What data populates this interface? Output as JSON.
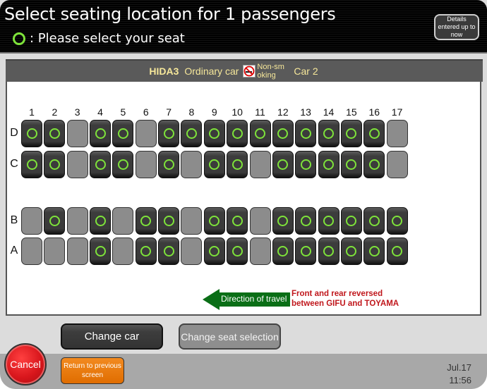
{
  "header": {
    "title": "Select seating location for 1 passengers",
    "legend_text": ": Please select your seat",
    "legend_icon": "green-circle-available-icon",
    "details_button": "Details entered up to now"
  },
  "car": {
    "train_name": "HIDA3",
    "car_type": "Ordinary car",
    "smoking_icon": "no-smoking-icon",
    "smoking_label": "Non-smoking",
    "car_number": "Car 2"
  },
  "seat_map": {
    "columns": [
      "1",
      "2",
      "3",
      "4",
      "5",
      "6",
      "7",
      "8",
      "9",
      "10",
      "11",
      "12",
      "13",
      "14",
      "15",
      "16",
      "17"
    ],
    "rows": [
      {
        "label": "D",
        "available": [
          true,
          true,
          false,
          true,
          true,
          false,
          true,
          true,
          true,
          true,
          true,
          true,
          true,
          true,
          true,
          true,
          false
        ]
      },
      {
        "label": "C",
        "available": [
          true,
          true,
          false,
          true,
          true,
          false,
          true,
          false,
          true,
          true,
          false,
          true,
          true,
          true,
          true,
          true,
          false
        ]
      },
      {
        "label": "B",
        "available": [
          false,
          true,
          false,
          true,
          false,
          true,
          true,
          false,
          true,
          true,
          false,
          true,
          true,
          true,
          true,
          true,
          true
        ]
      },
      {
        "label": "A",
        "available": [
          false,
          false,
          false,
          true,
          false,
          true,
          true,
          false,
          true,
          true,
          false,
          true,
          true,
          true,
          true,
          true,
          true
        ]
      }
    ],
    "available_color": "#7ee33a"
  },
  "direction": {
    "label": "Direction of travel",
    "arrow_icon": "arrow-left-icon",
    "note_line1": "Front and rear reversed",
    "note_line2": "between GIFU and TOYAMA"
  },
  "buttons": {
    "change_car": "Change car",
    "change_seat": "Change seat selection",
    "cancel": "Cancel",
    "return": "Return to previous screen"
  },
  "status": {
    "date": "Jul.17",
    "time": "11:56"
  }
}
